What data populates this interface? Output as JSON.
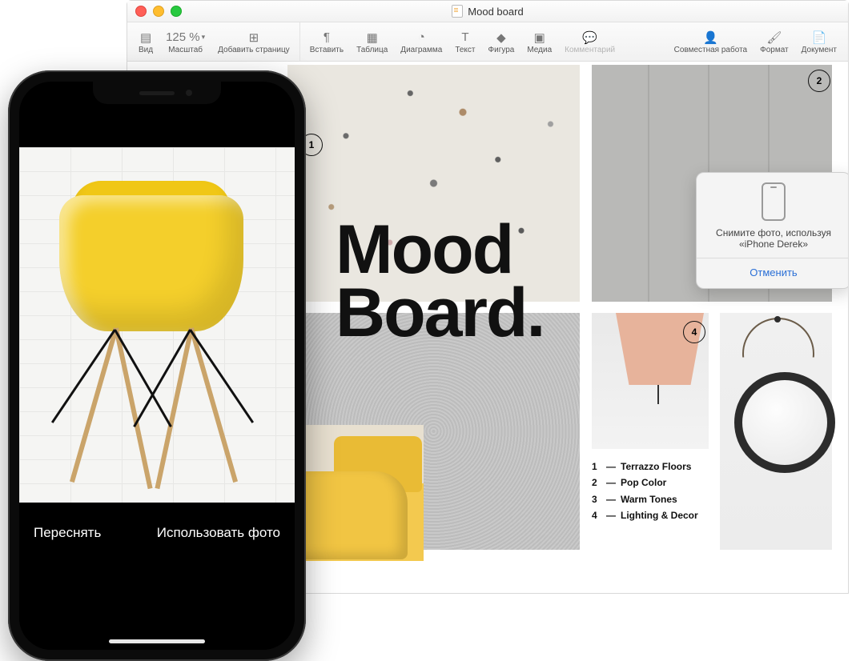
{
  "window": {
    "title": "Mood board"
  },
  "toolbar": {
    "view": "Вид",
    "zoom_value": "125 %",
    "zoom_label": "Масштаб",
    "add_page": "Добавить страницу",
    "insert": "Вставить",
    "table": "Таблица",
    "chart": "Диаграмма",
    "text": "Текст",
    "shape": "Фигура",
    "media": "Медиа",
    "comment": "Комментарий",
    "collaborate": "Совместная работа",
    "format": "Формат",
    "document": "Документ"
  },
  "document": {
    "title_line1": "Mood",
    "title_line2": "Board.",
    "markers": {
      "m1": "1",
      "m2": "2",
      "m4": "4"
    },
    "legend": [
      {
        "n": "1",
        "dash": "—",
        "label": "Terrazzo Floors"
      },
      {
        "n": "2",
        "dash": "—",
        "label": "Pop Color"
      },
      {
        "n": "3",
        "dash": "—",
        "label": "Warm Tones"
      },
      {
        "n": "4",
        "dash": "—",
        "label": "Lighting & Decor"
      }
    ]
  },
  "popover": {
    "text_line1": "Снимите фото, используя",
    "text_line2": "«iPhone Derek»",
    "cancel": "Отменить"
  },
  "iphone": {
    "retake": "Переснять",
    "use_photo": "Использовать фото"
  }
}
